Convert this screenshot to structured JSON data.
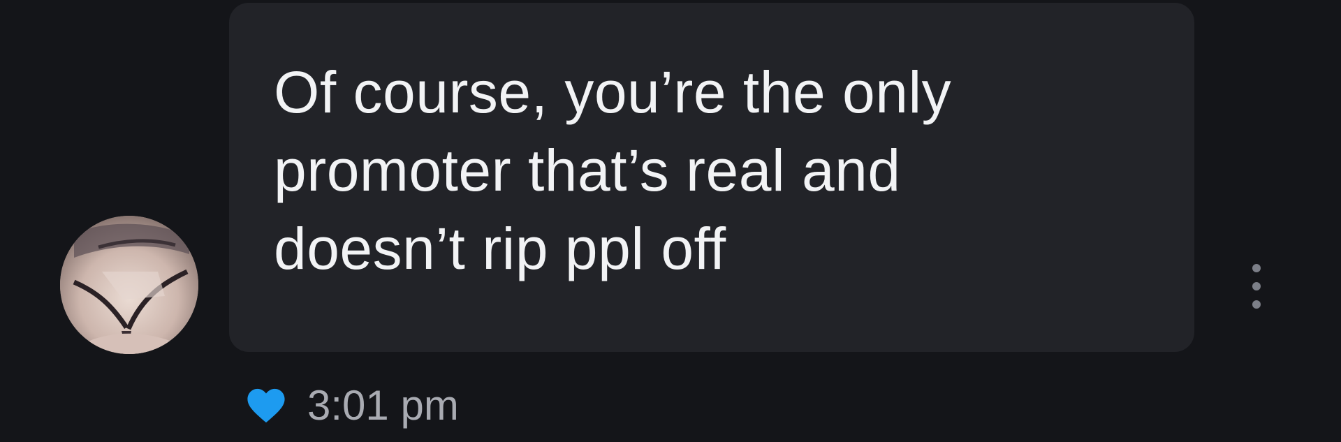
{
  "message": {
    "text": "Of course, you’re the only\npromoter that’s real and\ndoesn’t rip ppl off",
    "timestamp": "3:01 pm",
    "liked": true
  },
  "icons": {
    "avatar": "profile-photo",
    "more": "vertical-ellipsis-icon",
    "like": "heart-icon"
  },
  "colors": {
    "background": "#141519",
    "bubble": "#222328",
    "text": "#f2f3f5",
    "timestamp": "#a9abb2",
    "heart": "#1d9bf0",
    "more_dots": "#7c7f88"
  }
}
